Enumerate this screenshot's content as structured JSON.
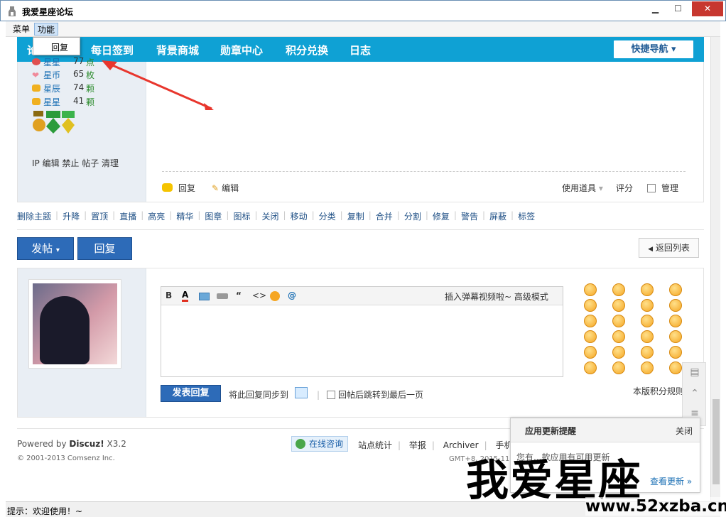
{
  "window": {
    "title": "我爱星座论坛",
    "min": "▁",
    "max": "☐",
    "close": "✕"
  },
  "menu": {
    "items": [
      "菜单",
      "功能"
    ],
    "dropdown_item": "回复"
  },
  "nav": {
    "items": [
      "论坛",
      "每日签到",
      "背景商城",
      "勋章中心",
      "积分兑换",
      "日志"
    ],
    "quick": "快捷导航"
  },
  "user_stats": [
    {
      "name": "星星",
      "value": "77",
      "unit": "点"
    },
    {
      "name": "星币",
      "value": "65",
      "unit": "枚"
    },
    {
      "name": "星辰",
      "value": "74",
      "unit": "颗"
    },
    {
      "name": "星星",
      "value": "41",
      "unit": "颗"
    }
  ],
  "admin_links": "IP 编辑 禁止 帖子 清理",
  "post_actions": {
    "reply": "回复",
    "edit": "编辑",
    "use_tool": "使用道具",
    "rate": "评分",
    "manage": "管理"
  },
  "mod_actions": [
    "删除主题",
    "升降",
    "置顶",
    "直播",
    "高亮",
    "精华",
    "图章",
    "图标",
    "关闭",
    "移动",
    "分类",
    "复制",
    "合并",
    "分割",
    "修复",
    "警告",
    "屏蔽",
    "标签"
  ],
  "buttons": {
    "post": "发帖",
    "reply": "回复",
    "back": "返回列表"
  },
  "editor": {
    "bold": "B",
    "color": "A",
    "quote": "“",
    "code": "<>",
    "at": "@",
    "right_links": "插入弹幕视频啦~  高级模式"
  },
  "reply_form": {
    "submit": "发表回复",
    "sync": "将此回复同步到",
    "jump": "回帖后跳转到最后一页",
    "rules": "本版积分规则"
  },
  "footer": {
    "powered_prefix": "Powered by ",
    "powered_brand": "Discuz!",
    "powered_ver": " X3.2",
    "copyright": "© 2001-2013 Comsenz Inc.",
    "online": "在线咨询",
    "links": [
      "站点统计",
      "举报",
      "Archiver",
      "手机版"
    ],
    "gmt": "GMT+8, 2015-11-"
  },
  "popup": {
    "title": "应用更新提醒",
    "close": "关闭",
    "message": "您有...款应用有可用更新",
    "more": "查看更新 »"
  },
  "status": "提示：欢迎使用！~",
  "watermark": {
    "big": "我爱星座",
    "small": "www.52xzba.cn"
  },
  "colors": {
    "nav_bg": "#0fa1d4",
    "button_blue": "#2d6bb8",
    "close_red": "#c7372f",
    "arrow_red": "#e8362d"
  }
}
